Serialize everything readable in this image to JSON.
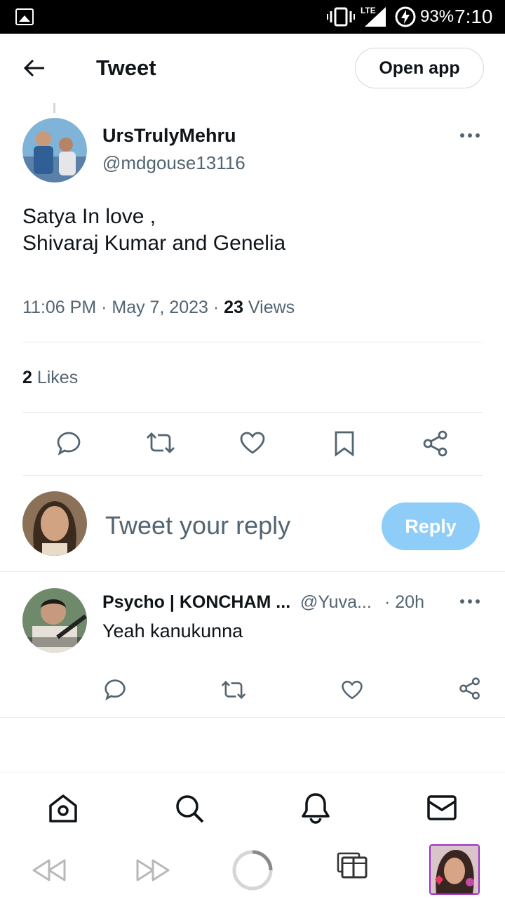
{
  "status_bar": {
    "network": "LTE",
    "battery": "93%",
    "time": "7:10"
  },
  "header": {
    "title": "Tweet",
    "open_app_label": "Open app"
  },
  "tweet": {
    "author_name": "UrsTrulyMehru",
    "author_handle": "@mdgouse13116",
    "text_line1": "Satya In love ,",
    "text_line2": "Shivaraj Kumar and Genelia",
    "timestamp": "11:06 PM · May 7, 2023 · ",
    "views_count": "23",
    "views_label": " Views",
    "likes_count": "2",
    "likes_label": " Likes"
  },
  "composer": {
    "placeholder": "Tweet your reply",
    "reply_label": "Reply"
  },
  "reply": {
    "author_name": "Psycho | KONCHAM ...",
    "author_handle": "@Yuva...",
    "age": "· 20h",
    "text": "Yeah kanukunna"
  },
  "colors": {
    "accent": "#1d9bf0",
    "reply_button": "#8ecdf8",
    "secondary_text": "#536471"
  },
  "icons": [
    "back-arrow",
    "more",
    "reply",
    "retweet",
    "like",
    "bookmark",
    "share",
    "home",
    "search",
    "notifications",
    "messages",
    "rewind",
    "fast-forward",
    "loading",
    "tabs"
  ]
}
